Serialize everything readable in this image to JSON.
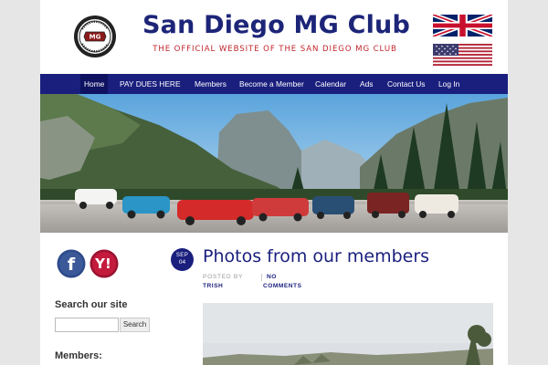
{
  "site": {
    "title": "San Diego MG Club",
    "tagline": "THE OFFICIAL WEBSITE OF THE SAN DIEGO MG CLUB",
    "logo_icon": "mg-club-badge-icon",
    "flags": [
      "uk-flag-icon",
      "us-flag-icon"
    ]
  },
  "nav": {
    "items": [
      {
        "label": "Home",
        "active": true
      },
      {
        "label": "PAY DUES HERE"
      },
      {
        "label": "Members"
      },
      {
        "label": "Become a Member"
      },
      {
        "label": "Calendar"
      },
      {
        "label": "Ads"
      },
      {
        "label": "Contact Us"
      },
      {
        "label": "Log In"
      }
    ]
  },
  "hero": {
    "icon": "yosemite-mg-lineup-photo"
  },
  "sidebar": {
    "social": [
      "facebook-icon",
      "yahoo-groups-icon"
    ],
    "search_heading": "Search our site",
    "search_placeholder": "",
    "search_button": "Search",
    "members_heading": "Members:"
  },
  "post": {
    "date_month": "SEP",
    "date_day": "04",
    "title": "Photos from our members",
    "posted_by_label": "POSTED BY",
    "author": "TRISH",
    "comments_line1": "NO",
    "comments_line2": "COMMENTS"
  },
  "colors": {
    "brand_navy": "#1a1f7e",
    "tagline_red": "#c0262d",
    "page_bg": "#e6e6e6"
  }
}
